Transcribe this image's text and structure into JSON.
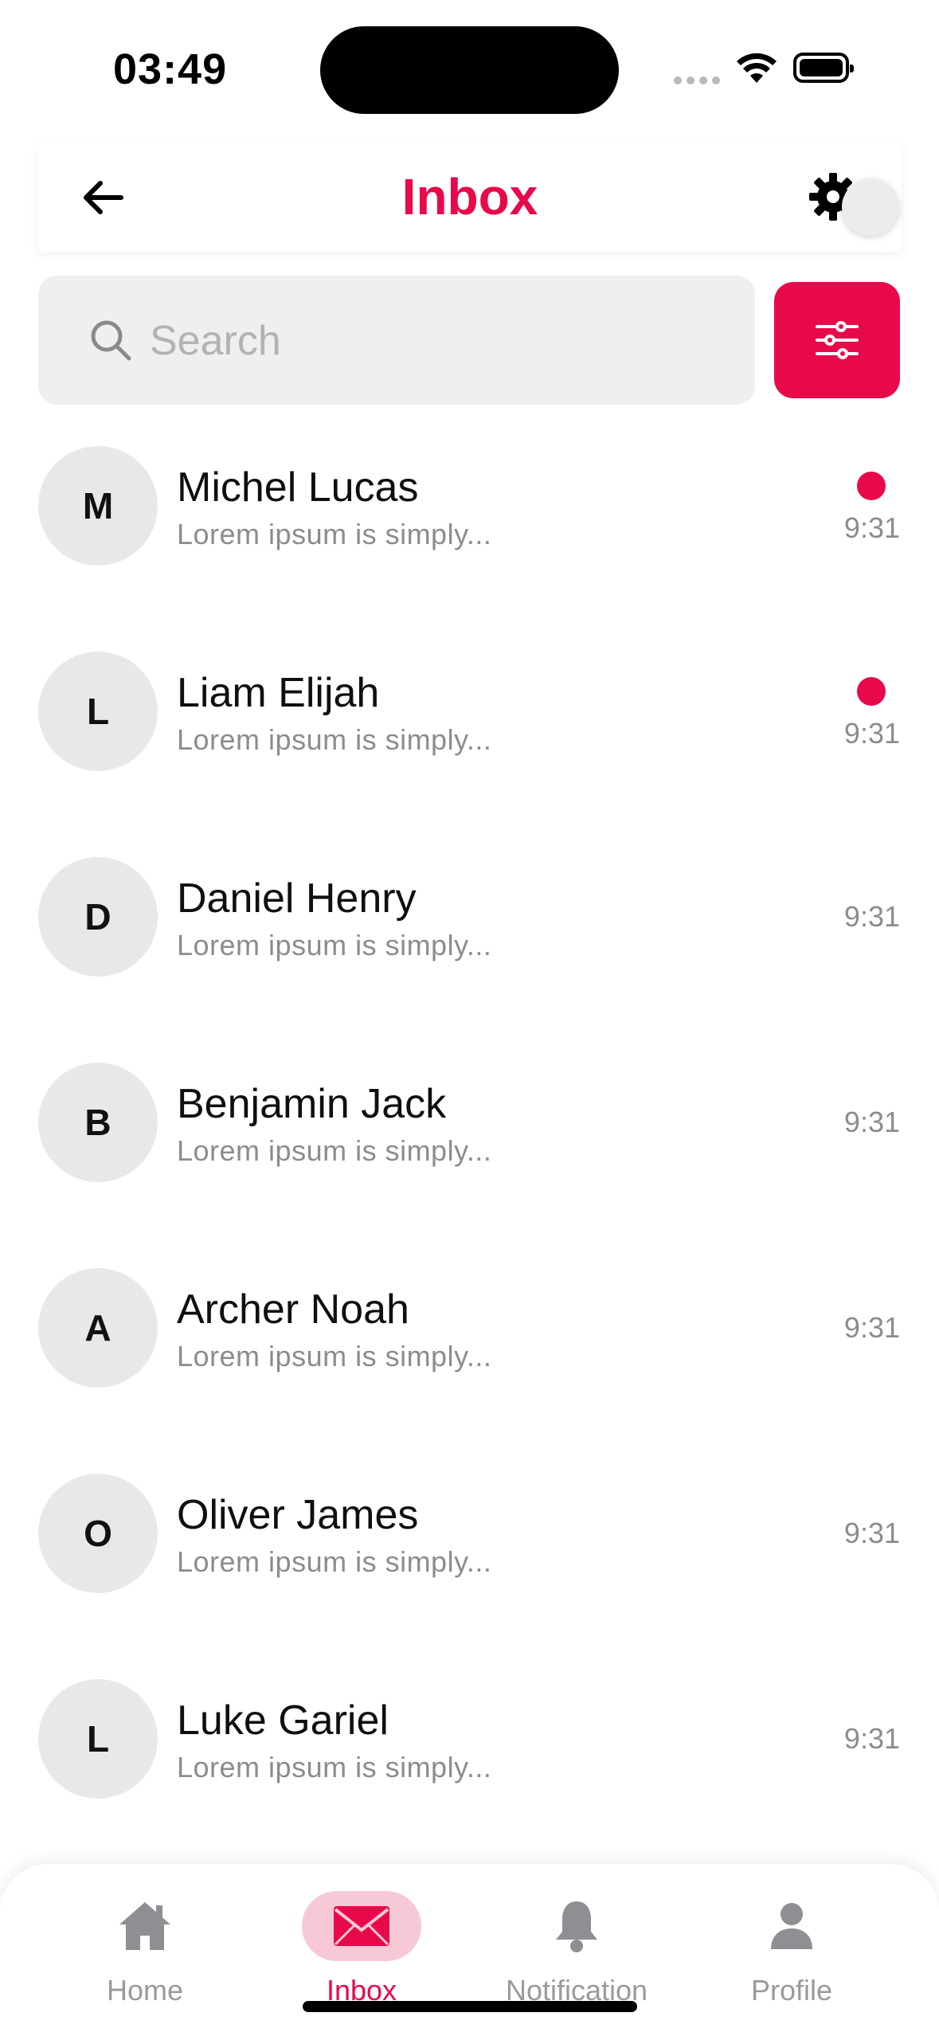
{
  "status_bar": {
    "time": "03:49"
  },
  "header": {
    "title": "Inbox"
  },
  "search": {
    "placeholder": "Search",
    "value": ""
  },
  "colors": {
    "accent": "#e8094b",
    "accent_soft": "#f7c9d7",
    "muted": "#8c8c8c"
  },
  "messages": [
    {
      "initial": "M",
      "name": "Michel Lucas",
      "preview": "Lorem ipsum is simply...",
      "time": "9:31",
      "unread": true
    },
    {
      "initial": "L",
      "name": "Liam Elijah",
      "preview": "Lorem ipsum is simply...",
      "time": "9:31",
      "unread": true
    },
    {
      "initial": "D",
      "name": "Daniel Henry",
      "preview": "Lorem ipsum is simply...",
      "time": "9:31",
      "unread": false
    },
    {
      "initial": "B",
      "name": "Benjamin Jack",
      "preview": "Lorem ipsum is simply...",
      "time": "9:31",
      "unread": false
    },
    {
      "initial": "A",
      "name": "Archer Noah",
      "preview": "Lorem ipsum is simply...",
      "time": "9:31",
      "unread": false
    },
    {
      "initial": "O",
      "name": "Oliver James",
      "preview": "Lorem ipsum is simply...",
      "time": "9:31",
      "unread": false
    },
    {
      "initial": "L",
      "name": "Luke Gariel",
      "preview": "Lorem ipsum is simply...",
      "time": "9:31",
      "unread": false
    }
  ],
  "nav": {
    "items": [
      {
        "label": "Home",
        "icon": "home-icon",
        "active": false
      },
      {
        "label": "Inbox",
        "icon": "mail-icon",
        "active": true
      },
      {
        "label": "Notification",
        "icon": "bell-icon",
        "active": false
      },
      {
        "label": "Profile",
        "icon": "person-icon",
        "active": false
      }
    ]
  }
}
